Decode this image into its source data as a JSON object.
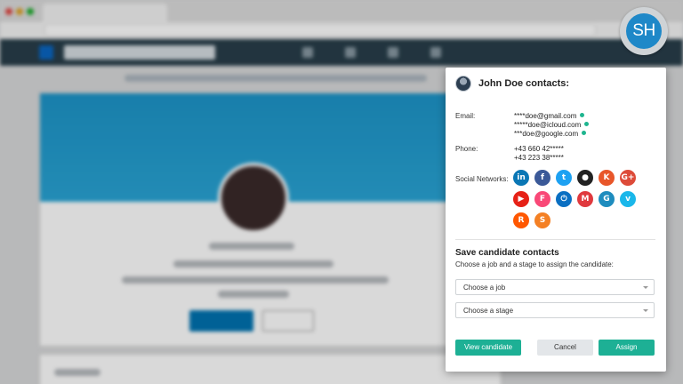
{
  "badge": {
    "initials": "SH"
  },
  "popup": {
    "title": "John Doe contacts:",
    "email": {
      "label": "Email:",
      "items": [
        "****doe@gmail.com",
        "*****doe@icloud.com",
        "***doe@google.com"
      ]
    },
    "phone": {
      "label": "Phone:",
      "items": [
        "+43 660 42*****",
        "+43 223 38*****"
      ]
    },
    "social": {
      "label": "Social Networks:",
      "networks": [
        {
          "name": "linkedin-icon",
          "glyph": "in",
          "color": "#0a77b5"
        },
        {
          "name": "facebook-icon",
          "glyph": "f",
          "color": "#3b5998"
        },
        {
          "name": "twitter-icon",
          "glyph": "t",
          "color": "#1da1f2"
        },
        {
          "name": "github-icon",
          "glyph": "●",
          "color": "#222222"
        },
        {
          "name": "klout-icon",
          "glyph": "K",
          "color": "#e8562a"
        },
        {
          "name": "googleplus-icon",
          "glyph": "G+",
          "color": "#dd4b39"
        },
        {
          "name": "youtube-icon",
          "glyph": "▶",
          "color": "#e62117"
        },
        {
          "name": "foursquare-icon",
          "glyph": "F",
          "color": "#f94877"
        },
        {
          "name": "power-icon",
          "glyph": "⏻",
          "color": "#0a6fc2"
        },
        {
          "name": "meetup-icon",
          "glyph": "M",
          "color": "#e0393e"
        },
        {
          "name": "gravatar-icon",
          "glyph": "G",
          "color": "#1e8cbe"
        },
        {
          "name": "vimeo-icon",
          "glyph": "v",
          "color": "#1ab7ea"
        },
        {
          "name": "reddit-icon",
          "glyph": "R",
          "color": "#ff5700"
        },
        {
          "name": "stackoverflow-icon",
          "glyph": "S",
          "color": "#f48024"
        }
      ]
    },
    "save": {
      "title": "Save candidate contacts",
      "subtitle": "Choose a job and a stage to assign the candidate:",
      "job_placeholder": "Choose a job",
      "stage_placeholder": "Choose a stage"
    },
    "buttons": {
      "view": "View candidate",
      "cancel": "Cancel",
      "assign": "Assign"
    }
  }
}
